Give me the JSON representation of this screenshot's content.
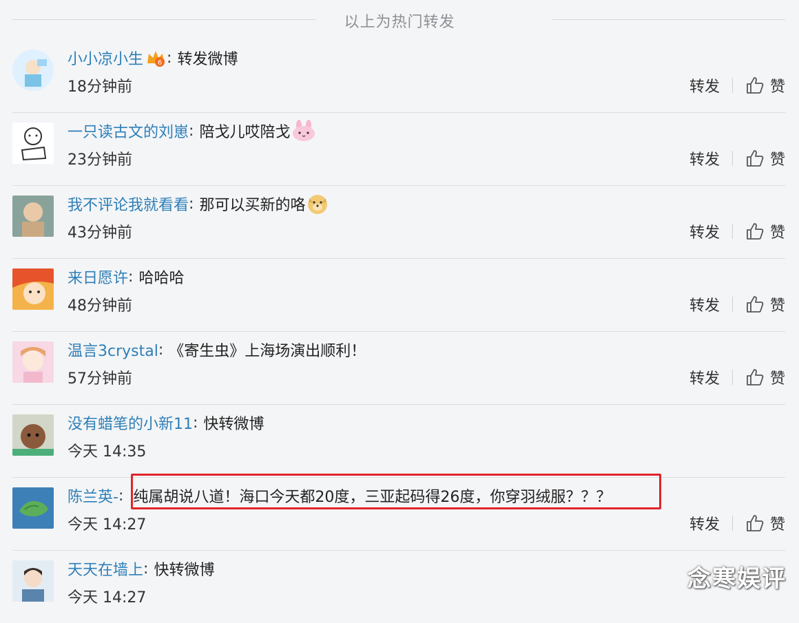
{
  "header": {
    "title": "以上为热门转发"
  },
  "actions": {
    "repost_label": "转发",
    "like_label": "赞"
  },
  "rows": [
    {
      "username": "小小凉小生",
      "sep": ":",
      "text": "转发微博",
      "time": "18分钟前",
      "badge_icon": "vip-crown-badge-icon"
    },
    {
      "username": "一只读古文的刘崽",
      "sep": ":",
      "text": "陪戈儿哎陪戈",
      "time": "23分钟前",
      "emoji_icon": "pink-bunny-emoji-icon"
    },
    {
      "username": "我不评论我就看看",
      "sep": ":",
      "text": "那可以买新的咯",
      "time": "43分钟前",
      "emoji_icon": "doge-emoji-icon"
    },
    {
      "username": "来日愿许",
      "sep": ":",
      "text": "哈哈哈",
      "time": "48分钟前"
    },
    {
      "username": "温言3crystal",
      "sep": ":",
      "text": "《寄生虫》上海场演出顺利！",
      "time": "57分钟前"
    },
    {
      "username": "没有蜡笔的小新11",
      "sep": ":",
      "text": "快转微博",
      "time": "今天 14:35"
    },
    {
      "username": "陈兰英-",
      "sep": ":",
      "text": "纯属胡说八道！海口今天都20度，三亚起码得26度，你穿羽绒服？？？",
      "time": "今天 14:27"
    },
    {
      "username": "天天在墙上",
      "sep": ":",
      "text": "快转微博",
      "time": "今天 14:27"
    }
  ],
  "watermark": "念寒娱评",
  "colors": {
    "username": "#2e7fb8",
    "highlight_border": "#e0252a",
    "background": "#f4f5f7"
  }
}
